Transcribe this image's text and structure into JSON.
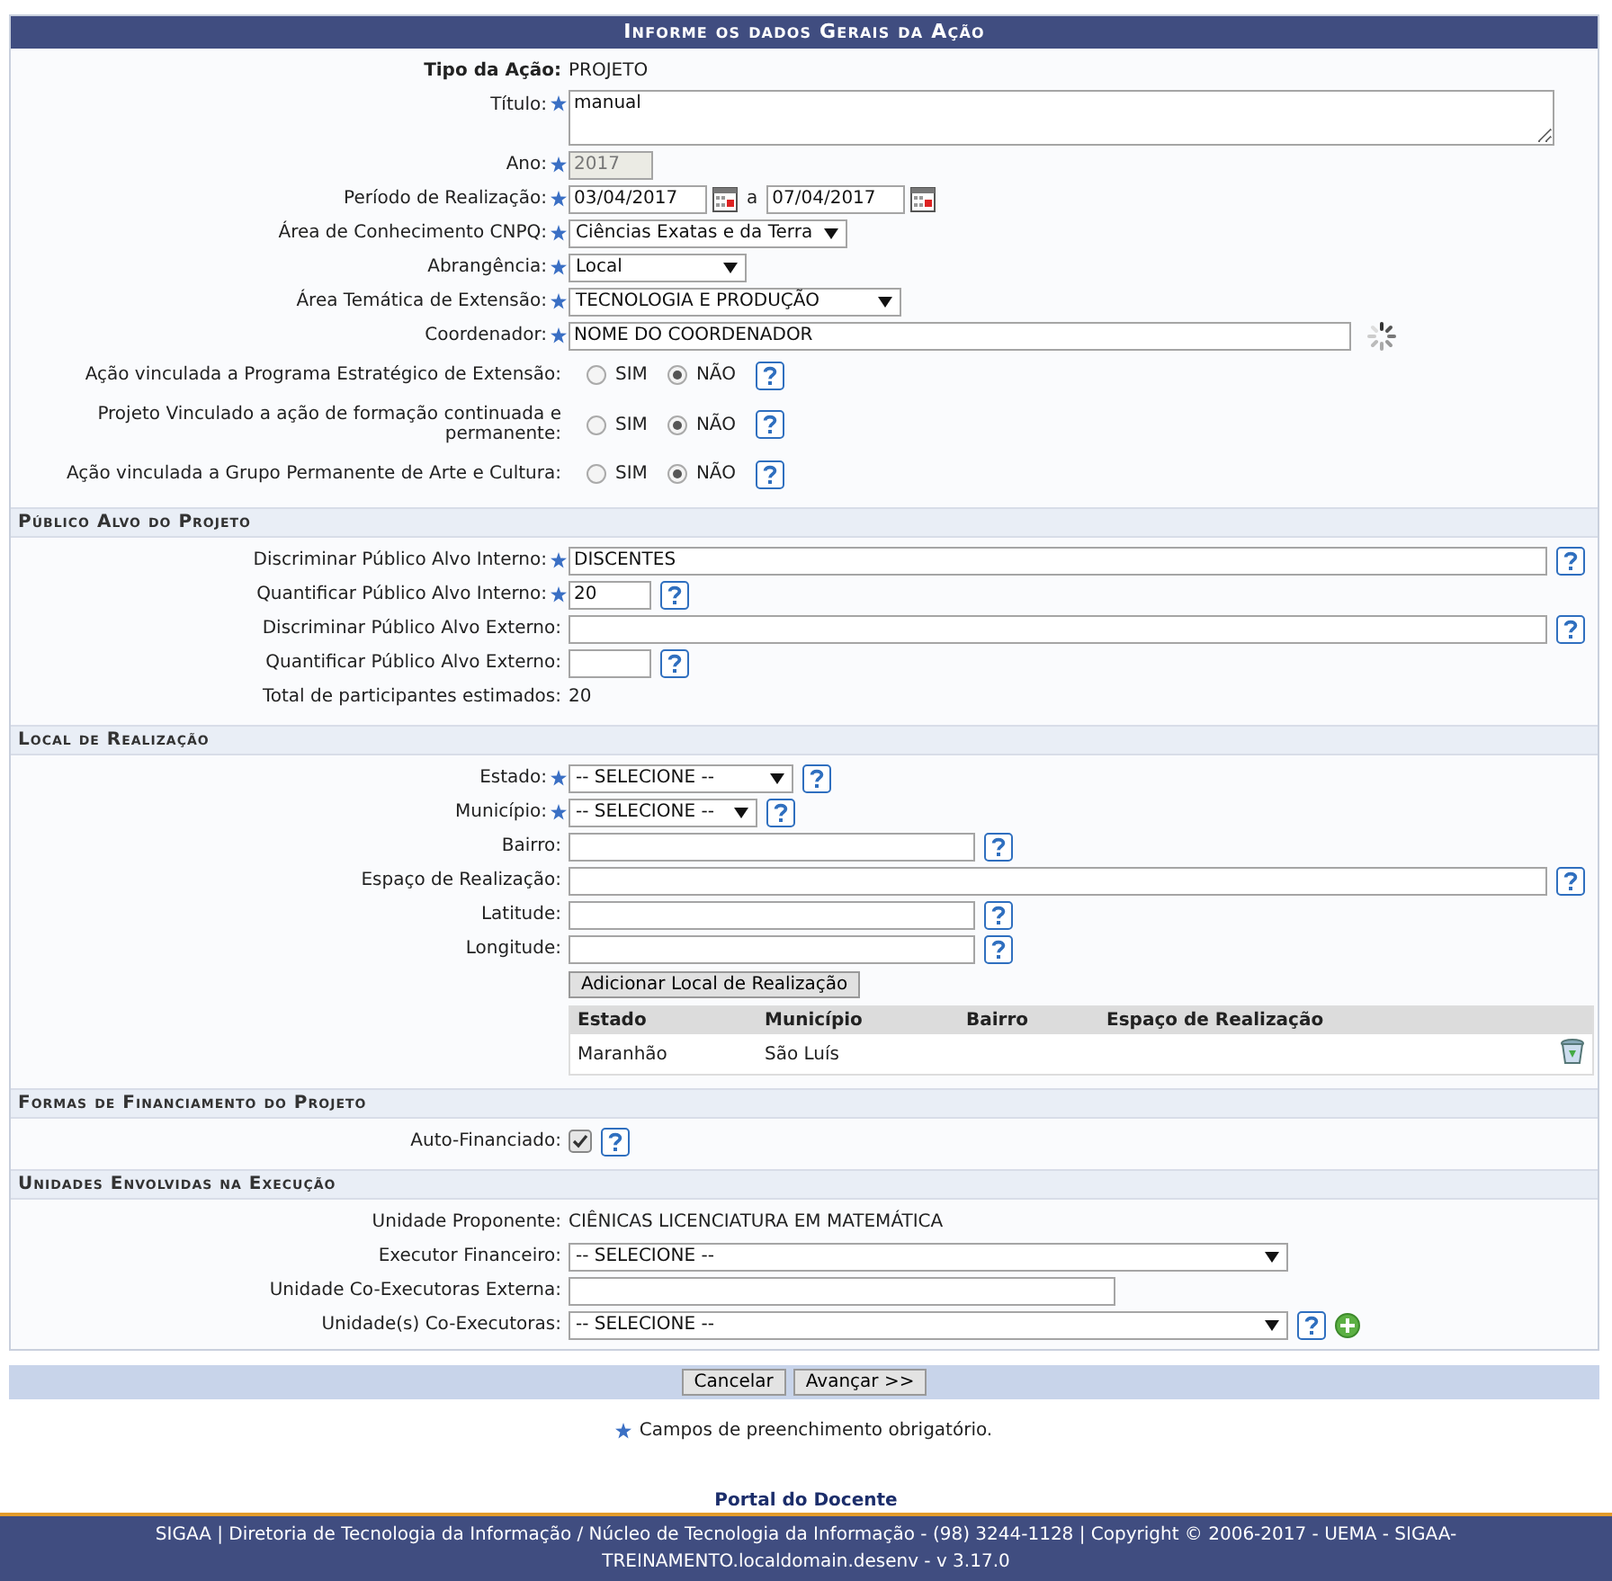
{
  "form": {
    "title": "Informe os dados Gerais da Ação",
    "sections": [
      {
        "rows": [
          {
            "kind": "text",
            "label": "Tipo da Ação:",
            "strong": true,
            "required": false,
            "value": "PROJETO"
          },
          {
            "kind": "textarea",
            "label": "Título:",
            "required": true,
            "value": "manual"
          },
          {
            "kind": "input",
            "label": "Ano:",
            "required": true,
            "value": "2017",
            "disabled": true
          },
          {
            "kind": "date-range",
            "label": "Período de Realização:",
            "required": true,
            "from": "03/04/2017",
            "separator": "a",
            "to": "07/04/2017"
          },
          {
            "kind": "select",
            "label": "Área de Conhecimento CNPQ:",
            "required": true,
            "value": "Ciências Exatas e da Terra"
          },
          {
            "kind": "select",
            "label": "Abrangência:",
            "required": true,
            "value": "Local"
          },
          {
            "kind": "select",
            "label": "Área Temática de Extensão:",
            "required": true,
            "value": "TECNOLOGIA E PRODUÇÃO"
          },
          {
            "kind": "input",
            "label": "Coordenador:",
            "required": true,
            "value": "NOME DO COORDENADOR",
            "loading": true
          },
          {
            "kind": "radio",
            "label": "Ação vinculada a Programa Estratégico de Extensão:",
            "required": false,
            "help": true,
            "options": [
              {
                "label": "SIM",
                "selected": false
              },
              {
                "label": "NÃO",
                "selected": true
              }
            ]
          },
          {
            "kind": "radio",
            "label": "Projeto Vinculado a ação de formação continuada e permanente:",
            "required": false,
            "help": true,
            "options": [
              {
                "label": "SIM",
                "selected": false
              },
              {
                "label": "NÃO",
                "selected": true
              }
            ]
          },
          {
            "kind": "radio",
            "label": "Ação vinculada a Grupo Permanente de Arte e Cultura:",
            "required": false,
            "help": true,
            "options": [
              {
                "label": "SIM",
                "selected": false
              },
              {
                "label": "NÃO",
                "selected": true
              }
            ]
          }
        ]
      },
      {
        "title": "Público Alvo do Projeto",
        "rows": [
          {
            "kind": "input",
            "label": "Discriminar Público Alvo Interno:",
            "required": true,
            "value": "DISCENTES",
            "help": true
          },
          {
            "kind": "input",
            "label": "Quantificar Público Alvo Interno:",
            "required": true,
            "value": "20",
            "help": true
          },
          {
            "kind": "input",
            "label": "Discriminar Público Alvo Externo:",
            "required": false,
            "help": true
          },
          {
            "kind": "input",
            "label": "Quantificar Público Alvo Externo:",
            "required": false,
            "help": true
          },
          {
            "kind": "text",
            "label": "Total de participantes estimados:",
            "required": false,
            "value": "20"
          }
        ]
      },
      {
        "title": "Local de Realização",
        "rows": [
          {
            "kind": "select",
            "label": "Estado:",
            "required": true,
            "value": "-- SELECIONE --",
            "help": true
          },
          {
            "kind": "select",
            "label": "Município:",
            "required": true,
            "value": "-- SELECIONE --",
            "help": true
          },
          {
            "kind": "input",
            "label": "Bairro:",
            "required": false,
            "help": true
          },
          {
            "kind": "input",
            "label": "Espaço de Realização:",
            "required": false,
            "help": true
          },
          {
            "kind": "input",
            "label": "Latitude:",
            "required": false,
            "help": true
          },
          {
            "kind": "input",
            "label": "Longitude:",
            "required": false,
            "help": true
          },
          {
            "kind": "button",
            "label": "Adicionar Local de Realização"
          },
          {
            "kind": "table",
            "columns": [
              "Estado",
              "Município",
              "Bairro",
              "Espaço de Realização"
            ],
            "rows": [
              {
                "cells": [
                  "Maranhão",
                  "São Luís"
                ],
                "removable": true
              }
            ]
          }
        ]
      },
      {
        "title": "Formas de Financiamento do Projeto",
        "rows": [
          {
            "kind": "checkbox",
            "label": "Auto-Financiado:",
            "required": false,
            "checked": true,
            "help": true
          }
        ]
      },
      {
        "title": "Unidades Envolvidas na Execução",
        "rows": [
          {
            "kind": "text",
            "label": "Unidade Proponente:",
            "required": false,
            "value": "CIÊNICAS LICENCIATURA EM MATEMÁTICA"
          },
          {
            "kind": "select",
            "label": "Executor Financeiro:",
            "required": false,
            "value": "-- SELECIONE --"
          },
          {
            "kind": "input",
            "label": "Unidade Co-Executoras Externa:",
            "required": false
          },
          {
            "kind": "select",
            "label": "Unidade(s) Co-Executoras:",
            "required": false,
            "value": "-- SELECIONE --",
            "help": true,
            "add": true
          }
        ]
      }
    ]
  },
  "actions": [
    "Cancelar",
    "Avançar >>"
  ],
  "legend": "Campos de preenchimento obrigatório.",
  "portal_link": "Portal do Docente",
  "footer": "SIGAA | Diretoria de Tecnologia da Informação / Núcleo de Tecnologia da Informação - (98) 3244-1128 | Copyright © 2006-2017 - UEMA - SIGAA-TREINAMENTO.localdomain.desenv - v 3.17.0"
}
